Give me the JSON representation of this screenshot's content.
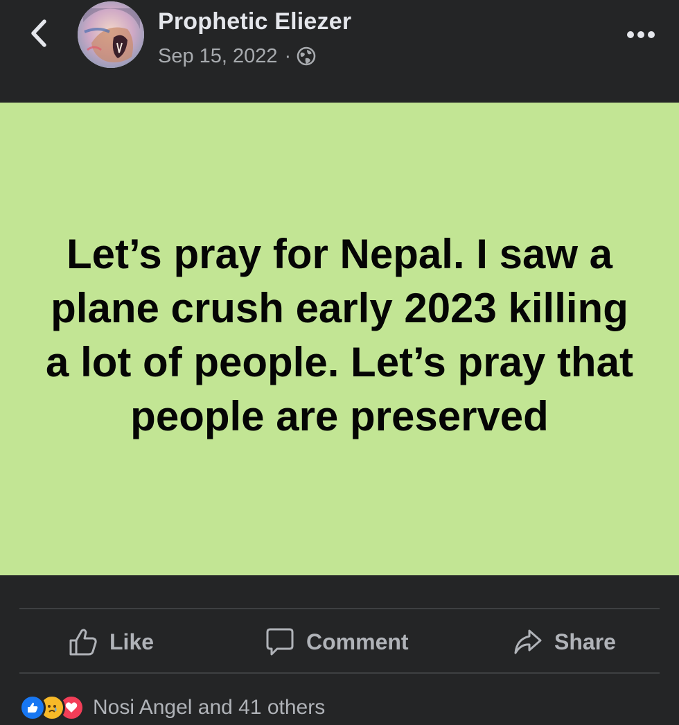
{
  "colors": {
    "background": "#242526",
    "post_background": "#c2e594",
    "post_text": "#050505",
    "name_text": "#e4e6eb",
    "secondary_text": "#b0b3b8",
    "like_blue": "#1877f2",
    "love_red": "#f33e58",
    "sad_yellow": "#f7b928"
  },
  "header": {
    "back_icon": "chevron-left-icon",
    "author_name": "Prophetic Eliezer",
    "date": "Sep 15, 2022",
    "separator": "·",
    "privacy_icon": "globe-icon",
    "more_icon": "ellipsis-icon"
  },
  "post": {
    "text": "Let’s pray for Nepal. I saw a plane crush early 2023 killing a lot of people. Let’s pray that people are preserved"
  },
  "actions": {
    "like": {
      "label": "Like",
      "icon": "thumbs-up-icon"
    },
    "comment": {
      "label": "Comment",
      "icon": "comment-icon"
    },
    "share": {
      "label": "Share",
      "icon": "share-arrow-icon"
    }
  },
  "reactions": {
    "icons": [
      "like-reaction-icon",
      "sad-reaction-icon",
      "love-reaction-icon"
    ],
    "summary": "Nosi Angel and 41 others"
  }
}
